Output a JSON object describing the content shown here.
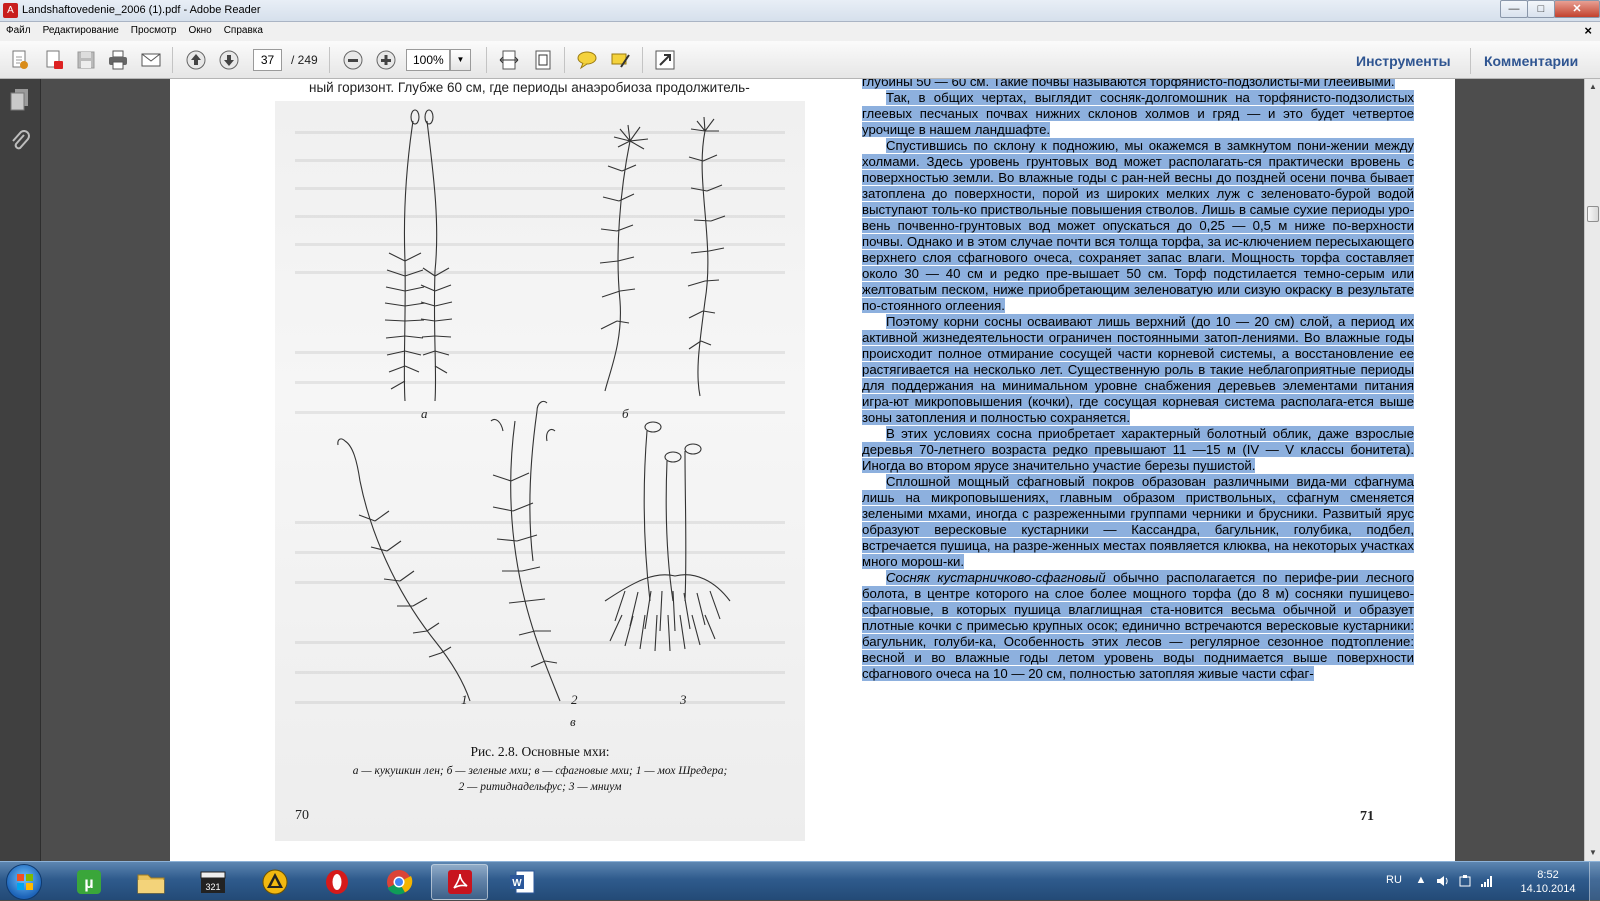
{
  "window": {
    "title": "Landshaftovedenie_2006 (1).pdf - Adobe Reader",
    "minimize": "—",
    "maximize": "□",
    "close": "✕"
  },
  "menu": {
    "items": [
      "Файл",
      "Редактирование",
      "Просмотр",
      "Окно",
      "Справка"
    ],
    "doc_close": "×"
  },
  "toolbar": {
    "page_current": "37",
    "page_total": "/ 249",
    "zoom": "100%",
    "tools_label": "Инструменты",
    "comments_label": "Комментарии"
  },
  "left_page": {
    "top_line": "ный горизонт. Глубже 60 см, где периоды анаэробиоза продолжитель-",
    "fig_labels": {
      "a": "а",
      "b": "б",
      "v": "в",
      "n1": "1",
      "n2": "2",
      "n3": "3"
    },
    "caption_title": "Рис. 2.8. Основные мхи:",
    "caption_line1": "а — кукушкин лен; б — зеленые мхи; в — сфагновые мхи; 1 — мох Шредера;",
    "caption_line2": "2 — ритиднадельфус; 3 — мниум",
    "page_number": "70"
  },
  "right_page": {
    "paragraphs": [
      {
        "indent": false,
        "text": "глубины 50 — 60 см. Такие почвы называются торфянисто-подзолисты-ми глееивыми."
      },
      {
        "indent": true,
        "text": "Так, в общих чертах, выглядит сосняк-долгомошник на торфянисто-подзолистых глеевых песчаных почвах нижних склонов холмов и гряд — и это будет четвертое урочище в нашем ландшафте."
      },
      {
        "indent": true,
        "text": "Спустившись по склону к подножию, мы окажемся в замкнутом пони-жении между холмами. Здесь уровень грунтовых вод может располагать-ся практически вровень с поверхностью земли. Во влажные годы с ран-ней весны до поздней осени почва бывает затоплена до поверхности, порой из широких мелких луж с зеленовато-бурой водой выступают толь-ко приствольные повышения стволов. Лишь в самые сухие периоды уро-вень почвенно-грунтовых вод может опускаться до 0,25 — 0,5 м ниже по-верхности почвы. Однако и в этом случае почти вся толща торфа, за ис-ключением пересыхающего верхнего слоя сфагнового очеса, сохраняет запас влаги. Мощность торфа составляет около 30 — 40 см и редко пре-вышает 50 см. Торф подстилается темно-серым или желтоватым песком, ниже приобретающим зеленоватую или сизую окраску в результате по-стоянного оглеения."
      },
      {
        "indent": true,
        "text": "Поэтому корни сосны осваивают лишь верхний (до 10 — 20 см) слой, а период их активной жизнедеятельности ограничен постоянными затоп-лениями. Во влажные годы происходит полное отмирание сосущей части корневой системы, а восстановление ее растягивается на несколько лет. Существенную роль в такие неблагоприятные периоды для поддержания на минимальном уровне снабжения деревьев элементами питания игра-ют микроповышения (кочки), где сосущая корневая система располага-ется выше зоны затопления и полностью сохраняется."
      },
      {
        "indent": true,
        "text": "В этих условиях сосна приобретает характерный болотный облик, даже взрослые деревья 70-летнего возраста редко превышают 11 —15 м (IV — V классы бонитета). Иногда во втором ярусе значительно участие березы пушистой."
      },
      {
        "indent": true,
        "text": "Сплошной мощный сфагновый покров образован различными вида-ми сфагнума лишь на микроповышениях, главным образом приствольных, сфагнум сменяется зелеными мхами, иногда с разреженными группами черники и брусники. Развитый ярус образуют вересковые кустарники — Кассандра, багульник, голубика, подбел, встречается пушица, на разре-женных местах появляется клюква, на некоторых участках много морош-ки."
      },
      {
        "indent": true,
        "italic_lead": "Сосняк кустарничково-сфагновый",
        "text": " обычно располагается по перифе-рии лесного болота, в центре которого на слое более мощного торфа (до 8 м) сосняки пушицево-сфагновые, в которых пушица влаглищная ста-новится весьма обычной и образует плотные кочки с примесью крупных осок; единично встречаются вересковые кустарники: багульник, голуби-ка, Особенность этих лесов — регулярное сезонное подтопление: весной и во влажные годы летом уровень воды поднимается выше поверхности сфагнового очеса на 10 — 20 см, полностью затопляя живые части сфаг-"
      }
    ],
    "page_number": "71"
  },
  "taskbar": {
    "lang": "RU",
    "time": "8:52",
    "date": "14.10.2014"
  },
  "colors": {
    "selection": "#8db0de",
    "accent_link": "#2f5591",
    "taskbar": "#2f5b8d"
  }
}
